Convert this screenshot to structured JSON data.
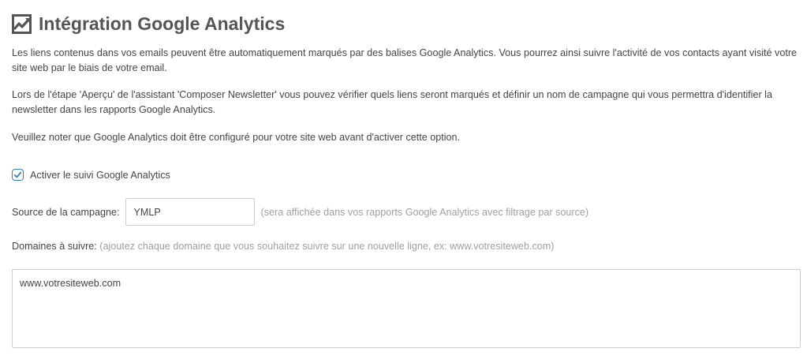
{
  "header": {
    "icon": "line-chart-icon",
    "title": "Intégration Google Analytics"
  },
  "description": {
    "paragraph1": "Les liens contenus dans vos emails peuvent être automatiquement marqués par des balises Google Analytics. Vous pourrez ainsi suivre l'activité de vos contacts ayant visité votre site web par le biais de votre email.",
    "paragraph2": "Lors de l'étape 'Aperçu' de l'assistant 'Composer Newsletter' vous pouvez vérifier quels liens seront marqués et définir un nom de campagne qui vous permettra d'identifier la newsletter dans les rapports Google Analytics.",
    "paragraph3": "Veuillez noter que Google Analytics doit être configuré pour votre site web avant d'activer cette option."
  },
  "tracking": {
    "checked": true,
    "label": "Activer le suivi Google Analytics",
    "checkbox_color": "#3a7fb5"
  },
  "campaign_source": {
    "label": "Source de la campagne:",
    "value": "YMLP",
    "hint": "(sera affichée dans vos rapports Google Analytics avec filtrage par source)"
  },
  "domains": {
    "label": "Domaines à suivre:",
    "hint": "(ajoutez chaque domaine que vous souhaitez suivre sur une nouvelle ligne, ex: www.votresiteweb.com)",
    "value": "www.votresiteweb.com"
  }
}
